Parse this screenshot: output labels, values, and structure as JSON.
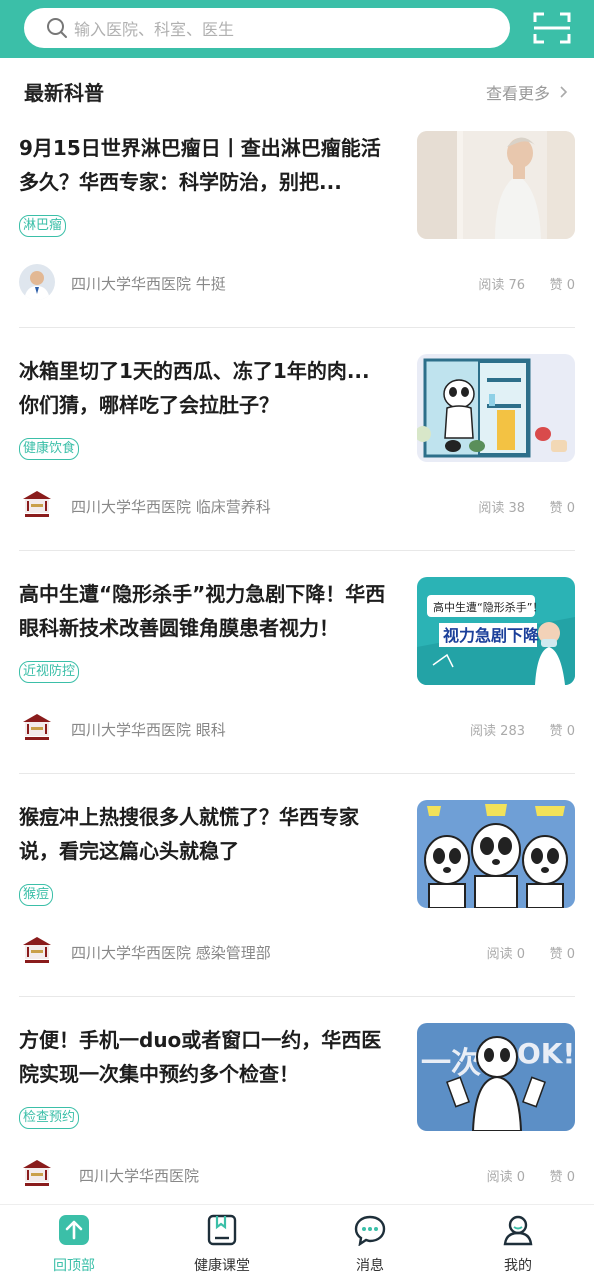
{
  "search": {
    "placeholder": "输入医院、科室、医生"
  },
  "section": {
    "title": "最新科普",
    "more_label": "查看更多"
  },
  "articles": [
    {
      "title": "9月15日世界淋巴瘤日丨查出淋巴瘤能活多久？华西专家：科学防治，别把...",
      "tag": "淋巴瘤",
      "source": "四川大学华西医院 牛挺",
      "reads": "阅读 76",
      "likes": "赞 0"
    },
    {
      "title": "冰箱里切了1天的西瓜、冻了1年的肉...你们猜，哪样吃了会拉肚子？",
      "tag": "健康饮食",
      "source": "四川大学华西医院 临床营养科",
      "reads": "阅读 38",
      "likes": "赞 0"
    },
    {
      "title": "高中生遭“隐形杀手”视力急剧下降！华西眼科新技术改善圆锥角膜患者视力！",
      "tag": "近视防控",
      "source": "四川大学华西医院 眼科",
      "reads": "阅读 283",
      "likes": "赞 0",
      "thumb_text1": "高中生遭“隐形杀手”！",
      "thumb_text2": "视力急剧下降"
    },
    {
      "title": "猴痘冲上热搜很多人就慌了？华西专家说，看完这篇心头就稳了",
      "tag": "猴痘",
      "source": "四川大学华西医院 感染管理部",
      "reads": "阅读 0",
      "likes": "赞 0"
    },
    {
      "title": "方便！手机一duo或者窗口一约，华西医院实现一次集中预约多个检查！",
      "tag": "检查预约",
      "source": "四川大学华西医院",
      "reads": "阅读 0",
      "likes": "赞 0",
      "thumb_text1": "一次",
      "thumb_text2": "OK!"
    }
  ],
  "nav": [
    {
      "label": "回顶部",
      "icon": "back-to-top-icon",
      "active": true
    },
    {
      "label": "健康课堂",
      "icon": "health-class-icon",
      "active": false
    },
    {
      "label": "消息",
      "icon": "message-icon",
      "active": false
    },
    {
      "label": "我的",
      "icon": "profile-icon",
      "active": false
    }
  ],
  "colors": {
    "accent": "#3bbfa8",
    "text": "#1d1d1d",
    "muted": "#888888"
  }
}
